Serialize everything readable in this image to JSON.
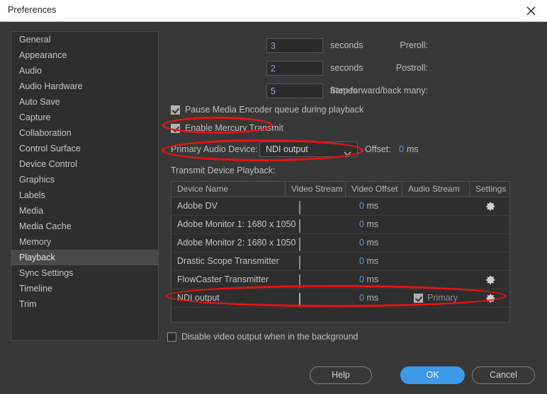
{
  "window": {
    "title": "Preferences",
    "close_icon": "close-icon"
  },
  "sidebar": {
    "items": [
      {
        "label": "General",
        "selected": false
      },
      {
        "label": "Appearance",
        "selected": false
      },
      {
        "label": "Audio",
        "selected": false
      },
      {
        "label": "Audio Hardware",
        "selected": false
      },
      {
        "label": "Auto Save",
        "selected": false
      },
      {
        "label": "Capture",
        "selected": false
      },
      {
        "label": "Collaboration",
        "selected": false
      },
      {
        "label": "Control Surface",
        "selected": false
      },
      {
        "label": "Device Control",
        "selected": false
      },
      {
        "label": "Graphics",
        "selected": false
      },
      {
        "label": "Labels",
        "selected": false
      },
      {
        "label": "Media",
        "selected": false
      },
      {
        "label": "Media Cache",
        "selected": false
      },
      {
        "label": "Memory",
        "selected": false
      },
      {
        "label": "Playback",
        "selected": true
      },
      {
        "label": "Sync Settings",
        "selected": false
      },
      {
        "label": "Timeline",
        "selected": false
      },
      {
        "label": "Trim",
        "selected": false
      }
    ]
  },
  "main": {
    "fields": [
      {
        "label": "Preroll:",
        "value": "3",
        "unit": "seconds"
      },
      {
        "label": "Postroll:",
        "value": "2",
        "unit": "seconds"
      },
      {
        "label": "Step forward/back many:",
        "value": "5",
        "unit": "frames"
      }
    ],
    "pause_encoder": {
      "label": "Pause Media Encoder queue during playback",
      "checked": true
    },
    "mercury_transmit": {
      "label": "Enable Mercury Transmit",
      "checked": true
    },
    "primary_audio": {
      "label": "Primary Audio Device:",
      "value": "NDI output",
      "offset_label": "Offset:",
      "offset_value": "0",
      "offset_unit": "ms"
    },
    "transmit_label": "Transmit Device Playback:",
    "table": {
      "columns": [
        "Device Name",
        "Video Stream",
        "Video Offset",
        "Audio Stream",
        "Settings"
      ],
      "rows": [
        {
          "name": "Adobe DV",
          "video_stream": false,
          "video_offset": "0",
          "video_offset_unit": "ms",
          "audio_stream_label": "",
          "audio_stream_checked": false,
          "settings": true
        },
        {
          "name": "Adobe Monitor 1: 1680 x 1050",
          "video_stream": false,
          "video_offset": "0",
          "video_offset_unit": "ms",
          "audio_stream_label": "",
          "audio_stream_checked": false,
          "settings": false
        },
        {
          "name": "Adobe Monitor 2: 1680 x 1050",
          "video_stream": false,
          "video_offset": "0",
          "video_offset_unit": "ms",
          "audio_stream_label": "",
          "audio_stream_checked": false,
          "settings": false
        },
        {
          "name": "Drastic Scope Transmitter",
          "video_stream": false,
          "video_offset": "0",
          "video_offset_unit": "ms",
          "audio_stream_label": "",
          "audio_stream_checked": false,
          "settings": false
        },
        {
          "name": "FlowCaster Transmitter",
          "video_stream": false,
          "video_offset": "0",
          "video_offset_unit": "ms",
          "audio_stream_label": "",
          "audio_stream_checked": false,
          "settings": true
        },
        {
          "name": "NDI output",
          "video_stream": true,
          "video_offset": "0",
          "video_offset_unit": "ms",
          "audio_stream_label": "Primary",
          "audio_stream_checked": true,
          "settings": true
        }
      ]
    },
    "disable_video_output": {
      "label": "Disable video output when in the background",
      "checked": false
    }
  },
  "buttons": {
    "help": "Help",
    "ok": "OK",
    "cancel": "Cancel"
  },
  "colors": {
    "accent": "#3d9ae8",
    "annotation": "#ee1111",
    "value_blue": "#5b9bd5",
    "panel": "#383838",
    "titlebar": "#ffffff"
  },
  "annotations": [
    {
      "name": "highlight-enable-mercury-transmit"
    },
    {
      "name": "highlight-primary-audio-device"
    },
    {
      "name": "highlight-ndi-output-row"
    }
  ]
}
